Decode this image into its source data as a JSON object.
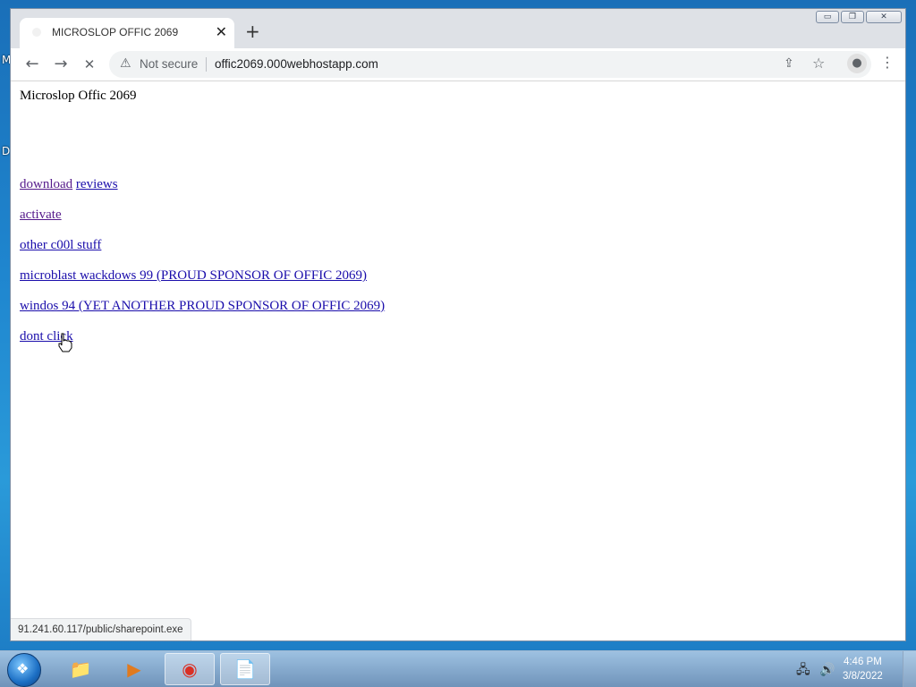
{
  "desktop": {
    "label_m": "M",
    "label_d": "D"
  },
  "window": {
    "tab_title": "MICROSLOP OFFIC 2069",
    "tab_close": "✕",
    "new_tab": "+",
    "controls": {
      "minimize": "▭",
      "restore": "❐",
      "close": "✕"
    }
  },
  "toolbar": {
    "back": "←",
    "forward": "→",
    "stop": "✕",
    "warning_icon": "⚠",
    "security_text": "Not secure",
    "url": "offic2069.000webhostapp.com",
    "share_icon": "⇪",
    "bookmark_icon": "☆",
    "profile_icon": "●",
    "menu_icon": "⋮"
  },
  "page": {
    "title": "Microslop Offic 2069",
    "links": {
      "download": "download",
      "reviews": "reviews",
      "activate": "activate",
      "other": "other c00l stuff",
      "microblast": "microblast wackdows 99 (PROUD SPONSOR OF OFFIC 2069)",
      "windos": "windos 94 (YET ANOTHER PROUD SPONSOR OF OFFIC 2069)",
      "dont_click": "dont click"
    }
  },
  "status_bar": {
    "text": "91.241.60.117/public/sharepoint.exe"
  },
  "taskbar": {
    "start_icon": "❖",
    "items": {
      "explorer_icon": "📁",
      "media_icon": "▶",
      "chrome_icon": "◉",
      "app_icon": "📄"
    },
    "tray": {
      "network_icon": "🖧",
      "volume_icon": "🔊"
    },
    "clock_time": "4:46 PM",
    "clock_date": "3/8/2022"
  }
}
